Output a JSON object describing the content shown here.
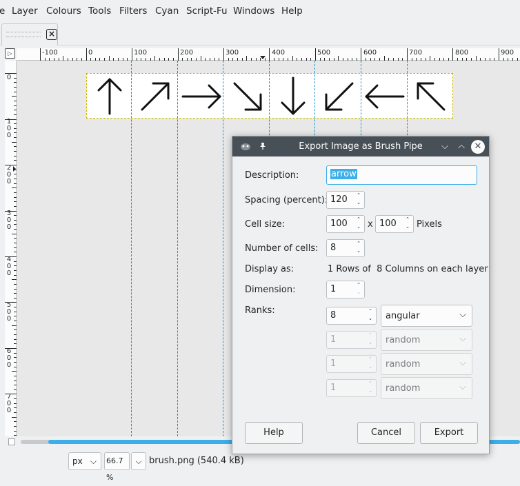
{
  "menubar": [
    "e",
    "Layer",
    "Colours",
    "Tools",
    "Filters",
    "Cyan",
    "Script-Fu",
    "Windows",
    "Help"
  ],
  "tab": {
    "close_glyph": "×"
  },
  "ruler": {
    "corner_glyph": "▷",
    "h_labels": [
      "-100",
      "0",
      "100",
      "200",
      "300",
      "400",
      "500",
      "600",
      "700",
      "800",
      "900"
    ],
    "v_labels": [
      [
        "0"
      ],
      [
        "1",
        "0",
        "0"
      ],
      [
        "2",
        "0",
        "0"
      ],
      [
        "3",
        "0",
        "0"
      ],
      [
        "4",
        "0",
        "0"
      ],
      [
        "5",
        "0",
        "0"
      ],
      [
        "6",
        "0",
        "0"
      ],
      [
        "7",
        "0",
        "0"
      ]
    ]
  },
  "canvas": {
    "arrow_directions": [
      "up",
      "up-right",
      "right",
      "down-right",
      "down",
      "down-left",
      "left",
      "up-left"
    ]
  },
  "status": {
    "unit": "px",
    "zoom": "66.7 %",
    "filename": "brush.png (540.4 kB)"
  },
  "dialog": {
    "title": "Export Image as Brush Pipe",
    "description_label": "Description:",
    "description_value": "arrow",
    "spacing_label": "Spacing (percent):",
    "spacing_value": "120",
    "cell_size_label": "Cell size:",
    "cell_width": "100",
    "cell_x": "x",
    "cell_height": "100",
    "cell_unit": "Pixels",
    "num_cells_label": "Number of cells:",
    "num_cells_value": "8",
    "display_as_label": "Display as:",
    "display_as_value": "1 Rows of  8 Columns on each layer",
    "dimension_label": "Dimension:",
    "dimension_value": "1",
    "ranks_label": "Ranks:",
    "ranks": [
      {
        "value": "8",
        "mode": "angular"
      },
      {
        "value": "1",
        "mode": "random"
      },
      {
        "value": "1",
        "mode": "random"
      },
      {
        "value": "1",
        "mode": "random"
      }
    ],
    "help_label": "Help",
    "cancel_label": "Cancel",
    "export_label": "Export"
  },
  "colors": {
    "titlebar": "#475057",
    "accent": "#3daee9",
    "guide": "#1d8fc9"
  }
}
